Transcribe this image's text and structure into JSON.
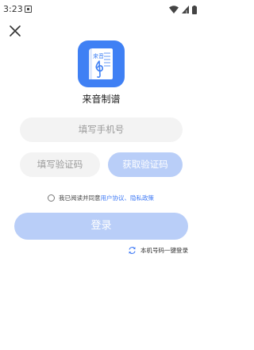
{
  "status_bar": {
    "time": "3:23"
  },
  "header": {
    "close_icon": "close-icon"
  },
  "app": {
    "logo_text": "来音",
    "name": "来音制谱"
  },
  "form": {
    "phone_placeholder": "填写手机号",
    "code_placeholder": "填写验证码",
    "get_code_label": "获取验证码"
  },
  "agreement": {
    "prefix": "我已阅读并同意",
    "user_agreement": "用户协议",
    "separator": "、",
    "privacy_policy": "隐私政策"
  },
  "actions": {
    "login_label": "登录",
    "one_key_login": "本机号码一键登录"
  },
  "colors": {
    "accent": "#3f7af5",
    "button_disabled": "#b9cef8",
    "field_bg": "#f3f3f3"
  }
}
